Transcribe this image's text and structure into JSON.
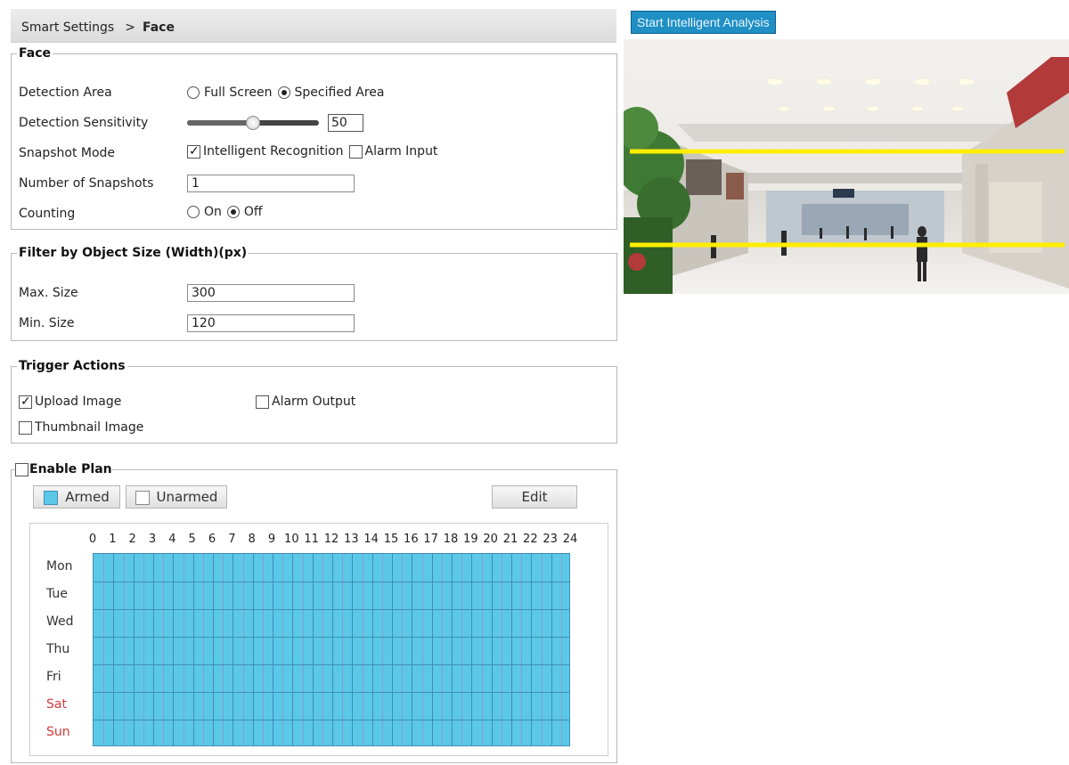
{
  "breadcrumb": {
    "parent": "Smart Settings",
    "separator": ">",
    "current": "Face"
  },
  "face": {
    "legend": "Face",
    "detection_area": {
      "label": "Detection Area",
      "options": [
        "Full Screen",
        "Specified Area"
      ],
      "selected": "Specified Area"
    },
    "detection_sensitivity": {
      "label": "Detection Sensitivity",
      "value": "50",
      "level_percent": 50
    },
    "snapshot_mode": {
      "label": "Snapshot Mode",
      "options": [
        {
          "label": "Intelligent Recognition",
          "checked": true
        },
        {
          "label": "Alarm Input",
          "checked": false
        }
      ]
    },
    "number_of_snapshots": {
      "label": "Number of Snapshots",
      "value": "1"
    },
    "counting": {
      "label": "Counting",
      "options": [
        "On",
        "Off"
      ],
      "selected": "Off"
    }
  },
  "filter": {
    "legend": "Filter by Object Size (Width)(px)",
    "max": {
      "label": "Max. Size",
      "value": "300"
    },
    "min": {
      "label": "Min. Size",
      "value": "120"
    }
  },
  "trigger": {
    "legend": "Trigger Actions",
    "upload_image": {
      "label": "Upload Image",
      "checked": true
    },
    "alarm_output": {
      "label": "Alarm Output",
      "checked": false
    },
    "thumbnail_image": {
      "label": "Thumbnail Image",
      "checked": false
    }
  },
  "plan": {
    "legend": "Enable Plan",
    "enabled": false,
    "armed_label": "Armed",
    "unarmed_label": "Unarmed",
    "edit_label": "Edit",
    "armed_color": "#5bc8e8",
    "hours": [
      "0",
      "1",
      "2",
      "3",
      "4",
      "5",
      "6",
      "7",
      "8",
      "9",
      "10",
      "11",
      "12",
      "13",
      "14",
      "15",
      "16",
      "17",
      "18",
      "19",
      "20",
      "21",
      "22",
      "23",
      "24"
    ],
    "days": [
      "Mon",
      "Tue",
      "Wed",
      "Thu",
      "Fri",
      "Sat",
      "Sun"
    ],
    "weekend_color": "#d23a3a"
  },
  "analysis": {
    "button_label": "Start Intelligent Analysis"
  },
  "video": {
    "line_color": "#ffee00",
    "icon": "camera-live-view"
  }
}
